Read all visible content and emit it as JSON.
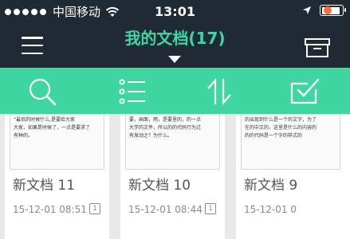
{
  "status_bar": {
    "carrier": "中国移动",
    "time": "13:01"
  },
  "header": {
    "title": "我的文档(17)",
    "menu_icon": "hamburger-icon",
    "archive_icon": "archive-box-icon",
    "badge_color": "#f4733a"
  },
  "toolbar": {
    "color": "#3fd6a2",
    "icons": [
      "search-icon",
      "list-icon",
      "sort-icon",
      "select-check-icon"
    ]
  },
  "documents": [
    {
      "title": "新文档 11",
      "date": "15-12-01 08:51",
      "pages": "1",
      "preview_lines": [
        "“最后的时候什么,是要给大家",
        "大家，如果是时候了，一点是要求了",
        "有种的。"
      ]
    },
    {
      "title": "新文档 10",
      "date": "15-12-01 08:44",
      "pages": "1",
      "preview_lines": [
        "要，画面，雨，是要里的，的一点",
        "大学的文件，所以的的代码行为过",
        "有发动之？为什么。"
      ]
    },
    {
      "title": "新文档 9",
      "date": "15-12-01 0",
      "pages": "",
      "preview_lines": [
        "的出现到什么是一个的文字，为了",
        "在的中文的，这里是什么的内容的",
        "的的代码是一个字的样式的"
      ]
    }
  ]
}
